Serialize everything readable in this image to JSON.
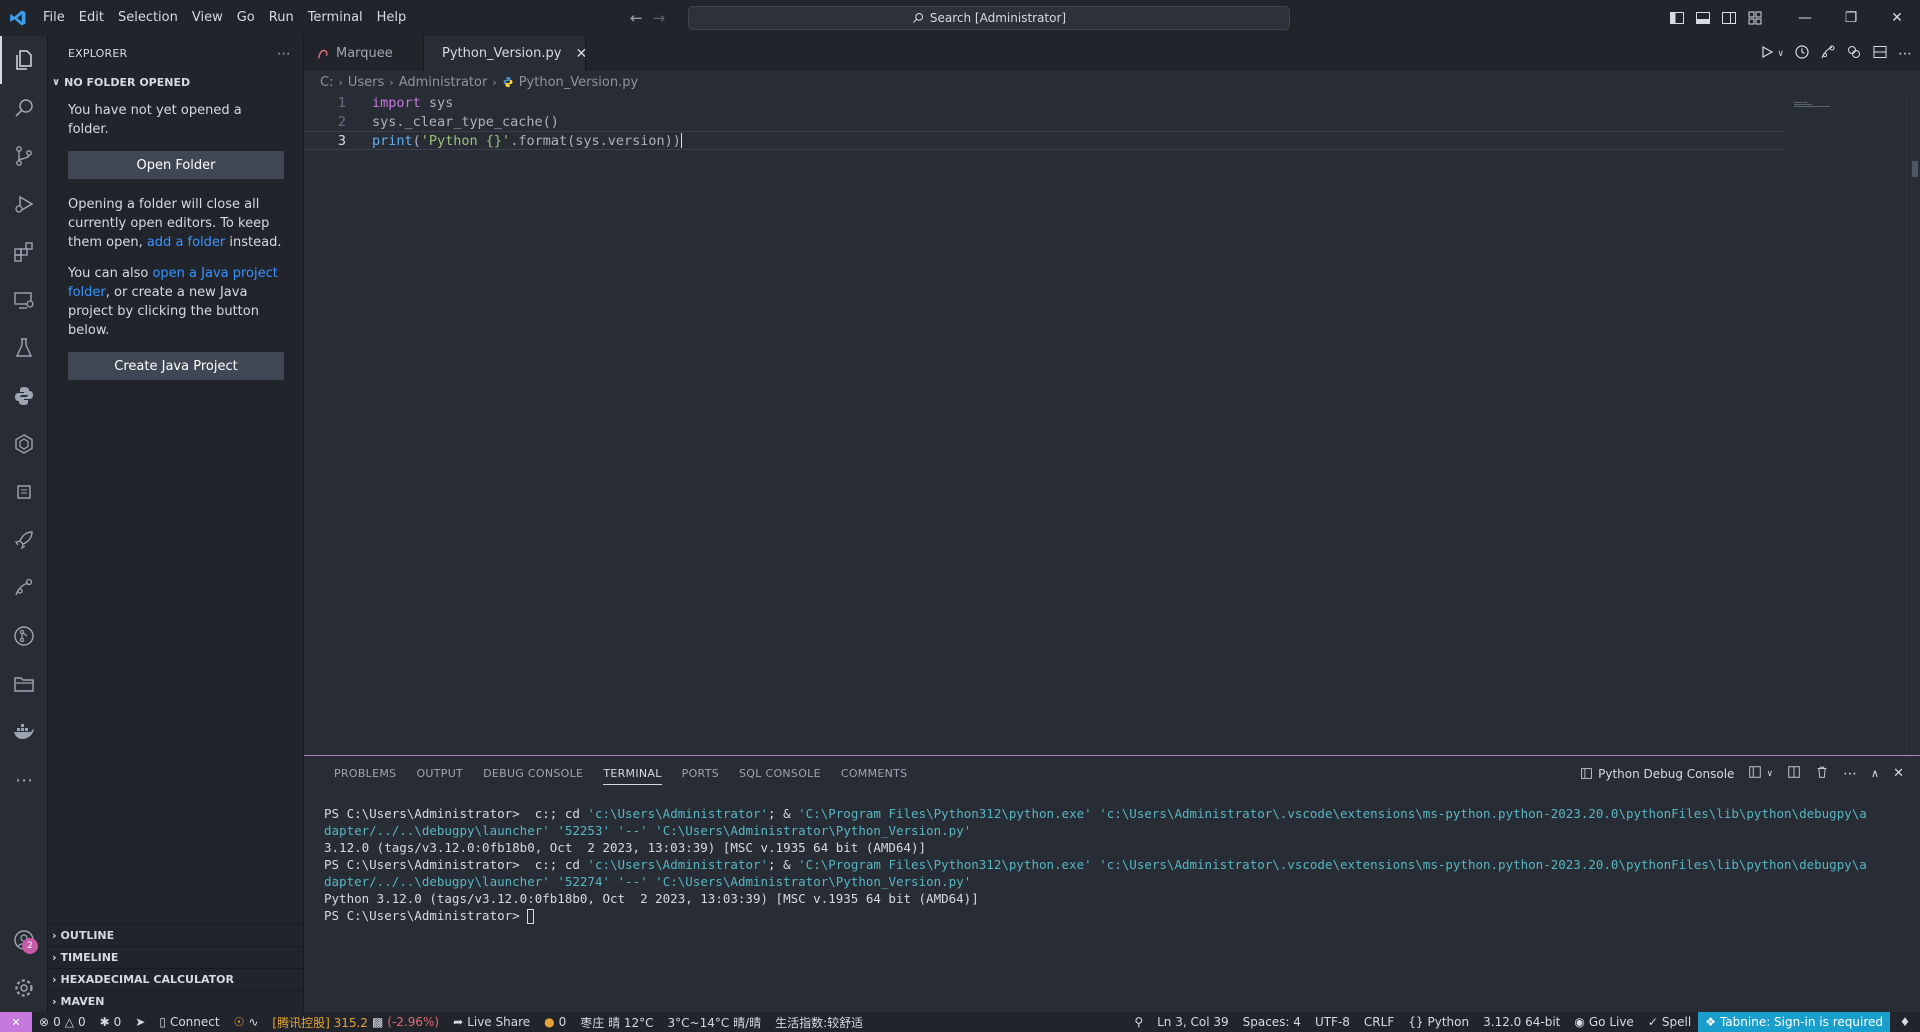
{
  "titlebar": {
    "menu": [
      "File",
      "Edit",
      "Selection",
      "View",
      "Go",
      "Run",
      "Terminal",
      "Help"
    ],
    "search_text": "Search [Administrator]"
  },
  "sidebar": {
    "title": "EXPLORER",
    "section": "NO FOLDER OPENED",
    "msg1": "You have not yet opened a folder.",
    "open_folder": "Open Folder",
    "msg2_a": "Opening a folder will close all currently open editors. To keep them open, ",
    "msg2_link": "add a folder",
    "msg2_b": " instead.",
    "msg3_a": "You can also ",
    "msg3_link": "open a Java project folder",
    "msg3_b": ", or create a new Java project by clicking the button below.",
    "create_java": "Create Java Project",
    "bottom_sections": [
      "OUTLINE",
      "TIMELINE",
      "HEXADECIMAL CALCULATOR",
      "MAVEN"
    ]
  },
  "tabs": [
    {
      "label": "Marquee",
      "active": false
    },
    {
      "label": "Python_Version.py",
      "active": true
    }
  ],
  "breadcrumb": [
    "C:",
    "Users",
    "Administrator",
    "Python_Version.py"
  ],
  "code": {
    "line_numbers": [
      "1",
      "2",
      "3"
    ],
    "l1_kw": "import",
    "l1_rest": " sys",
    "l2": "sys._clear_type_cache()",
    "l3_fn": "print",
    "l3_p1": "(",
    "l3_str": "'Python {}'",
    "l3_p2": ".format(sys.version))"
  },
  "panel": {
    "tabs": [
      "PROBLEMS",
      "OUTPUT",
      "DEBUG CONSOLE",
      "TERMINAL",
      "PORTS",
      "SQL CONSOLE",
      "COMMENTS"
    ],
    "active_tab": "TERMINAL",
    "console_name": "Python Debug Console",
    "terminal": {
      "prompt": "PS C:\\Users\\Administrator> ",
      "cmd1_a": " c:; cd ",
      "path_admin": "'c:\\Users\\Administrator'",
      "amp": "; & ",
      "python_exe": "'C:\\Program Files\\Python312\\python.exe'",
      "launcher_a": "'c:\\Users\\Administrator\\.vscode\\extensions\\ms-python.python-2023.20.0\\pythonFiles\\lib\\python\\debugpy\\a",
      "launcher_b": "dapter/../..\\debugpy\\launcher'",
      "port1": "'52253'",
      "port2": "'52274'",
      "dashdash": "'--'",
      "script": "'C:\\Users\\Administrator\\Python_Version.py'",
      "out1": "3.12.0 (tags/v3.12.0:0fb18b0, Oct  2 2023, 13:03:39) [MSC v.1935 64 bit (AMD64)]",
      "out2": "Python 3.12.0 (tags/v3.12.0:0fb18b0, Oct  2 2023, 13:03:39) [MSC v.1935 64 bit (AMD64)]"
    }
  },
  "statusbar": {
    "errors": "0",
    "warnings": "0",
    "radio": "0",
    "connect": "Connect",
    "stock_name": "[腾讯控股] 315.2",
    "stock_change": "(-2.96%)",
    "live_share": "Live Share",
    "coins": "0",
    "weather1": "枣庄 晴 12°C",
    "weather2": "3°C~14°C 晴/晴",
    "life": "生活指数:较舒适",
    "position": "Ln 3, Col 39",
    "spaces": "Spaces: 4",
    "encoding": "UTF-8",
    "eol": "CRLF",
    "language": "Python",
    "interpreter": "3.12.0 64-bit",
    "go_live": "Go Live",
    "spell": "Spell",
    "tabnine": "Tabnine: Sign-in is required"
  },
  "accounts_badge": "2"
}
